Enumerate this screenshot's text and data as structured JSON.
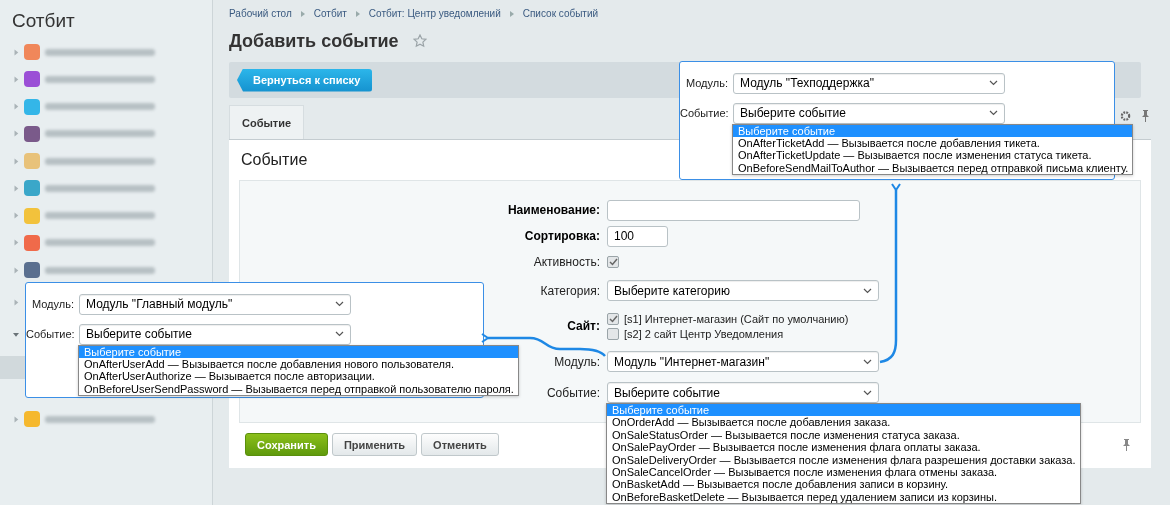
{
  "sidebar": {
    "title": "Сотбит",
    "items": [
      {
        "color": "#f0875a",
        "expanded": false
      },
      {
        "color": "#9b4fd6",
        "expanded": false
      },
      {
        "color": "#34b6e8",
        "expanded": false
      },
      {
        "color": "#7a5a8a",
        "expanded": false
      },
      {
        "color": "#e8c27a",
        "expanded": false
      },
      {
        "color": "#3aa7c9",
        "expanded": false
      },
      {
        "color": "#f2c23c",
        "expanded": false
      },
      {
        "color": "#f06a4a",
        "expanded": false
      },
      {
        "color": "#5a6f8f",
        "expanded": false
      },
      {
        "expanded": false
      },
      {
        "expanded": true,
        "children": [
          {
            "selected": true
          }
        ]
      },
      {
        "color": "#f5b82e",
        "expanded": false
      }
    ]
  },
  "breadcrumbs": [
    "Рабочий стол",
    "Сотбит",
    "Сотбит: Центр уведомлений",
    "Список событий"
  ],
  "page_title": "Добавить событие",
  "back_button": "Вернуться к списку",
  "tabs": [
    {
      "label": "Событие",
      "selected": true
    }
  ],
  "section_title": "Событие",
  "form": {
    "fields": [
      {
        "kind": "text",
        "label": "Наименование:",
        "required": true
      },
      {
        "kind": "text",
        "label": "Сортировка:",
        "required": true,
        "value": "100"
      },
      {
        "kind": "checkbox",
        "label": "Активность:",
        "required": false,
        "checked": true
      },
      {
        "kind": "select",
        "label": "Категория:",
        "required": false,
        "value": "Выберите категорию"
      },
      {
        "kind": "checklist",
        "label": "Сайт:",
        "required": true,
        "options": [
          {
            "label": "[s1] Интернет-магазин (Сайт по умолчанию)",
            "checked": true
          },
          {
            "label": "[s2] 2 сайт Центр Уведомления",
            "checked": false
          }
        ]
      },
      {
        "kind": "select",
        "label": "Модуль:",
        "required": false,
        "value": "Модуль \"Интернет-магазин\""
      },
      {
        "kind": "select",
        "label": "Событие:",
        "required": false,
        "value": "Выберите событие",
        "open": true,
        "options": [
          {
            "label": "Выберите событие",
            "selected": true
          },
          {
            "label": "OnOrderAdd — Вызывается после добавления заказа.",
            "selected": false
          },
          {
            "label": "OnSaleStatusOrder — Вызывается после изменения статуса заказа.",
            "selected": false
          },
          {
            "label": "OnSalePayOrder — Вызывается после изменения флага оплаты заказа.",
            "selected": false
          },
          {
            "label": "OnSaleDeliveryOrder — Вызывается после изменения флага разрешения доставки заказа.",
            "selected": false
          },
          {
            "label": "OnSaleCancelOrder — Вызывается после изменения флага отмены заказа.",
            "selected": false
          },
          {
            "label": "OnBasketAdd — Вызывается после добавления записи в корзину.",
            "selected": false
          },
          {
            "label": "OnBeforeBasketDelete — Вызывается перед удалением записи из корзины.",
            "selected": false
          }
        ]
      }
    ]
  },
  "buttons": [
    {
      "label": "Сохранить",
      "kind": "primary"
    },
    {
      "label": "Применить",
      "kind": "secondary"
    },
    {
      "label": "Отменить",
      "kind": "secondary"
    }
  ],
  "callouts": [
    {
      "fields": [
        {
          "kind": "select",
          "label": "Модуль:",
          "value": "Модуль \"Техподдержка\""
        },
        {
          "kind": "select",
          "label": "Событие:",
          "value": "Выберите событие",
          "open": true,
          "options": [
            {
              "label": "Выберите событие",
              "selected": true
            },
            {
              "label": "OnAfterTicketAdd — Вызывается после добавления тикета.",
              "selected": false
            },
            {
              "label": "OnAfterTicketUpdate — Вызывается после изменения статуса тикета.",
              "selected": false
            },
            {
              "label": "OnBeforeSendMailToAuthor — Вызывается перед отправкой письма клиенту.",
              "selected": false
            }
          ]
        }
      ]
    },
    {
      "fields": [
        {
          "kind": "select",
          "label": "Модуль:",
          "value": "Модуль \"Главный модуль\""
        },
        {
          "kind": "select",
          "label": "Событие:",
          "value": "Выберите событие",
          "open": true,
          "options": [
            {
              "label": "Выберите событие",
              "selected": true
            },
            {
              "label": "OnAfterUserAdd — Вызывается после добавления нового пользователя.",
              "selected": false
            },
            {
              "label": "OnAfterUserAuthorize — Вызывается после авторизации.",
              "selected": false
            },
            {
              "label": "OnBeforeUserSendPassword — Вызывается перед отправкой пользователю пароля.",
              "selected": false
            }
          ]
        }
      ]
    }
  ]
}
